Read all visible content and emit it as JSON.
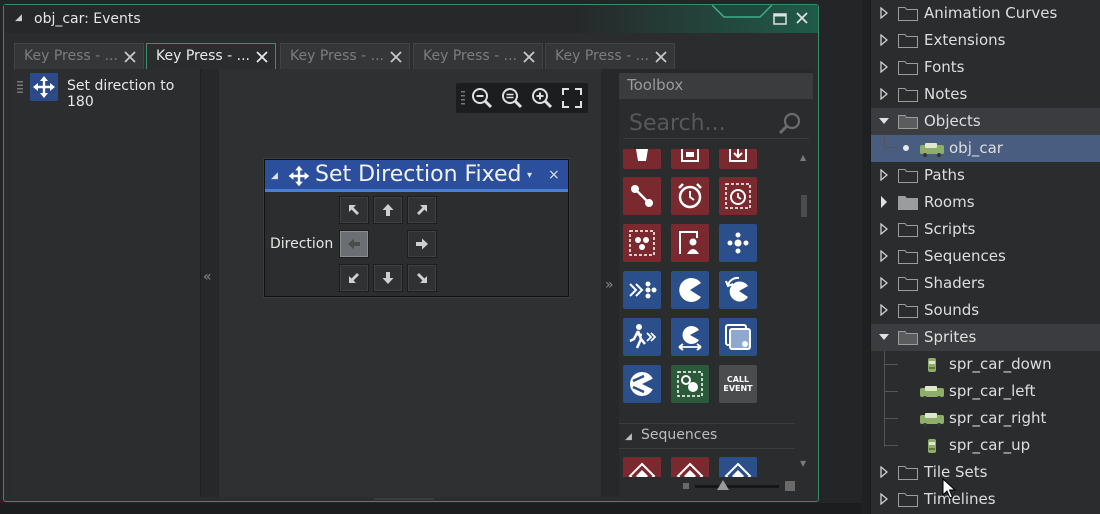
{
  "window": {
    "title": "obj_car: Events"
  },
  "tabs": [
    {
      "label": "Key Press - ...",
      "active": false
    },
    {
      "label": "Key Press - ...",
      "active": true
    },
    {
      "label": "Key Press - ...",
      "active": false
    },
    {
      "label": "Key Press - ...",
      "active": false
    },
    {
      "label": "Key Press - ...",
      "active": false
    }
  ],
  "actions_list": {
    "items": [
      {
        "label": "Set direction to 180",
        "icon": "move-arrows-icon"
      }
    ]
  },
  "canvas": {
    "collapse_left": "«",
    "collapse_right": "»",
    "zoom_tools": [
      "zoom-out-icon",
      "zoom-reset-icon",
      "zoom-in-icon",
      "fit-screen-icon"
    ]
  },
  "node": {
    "title": "Set Direction Fixed",
    "direction_label": "Direction",
    "selected_direction": "left",
    "dropdown_glyph": "▾",
    "close_glyph": "×"
  },
  "toolbox": {
    "header": "Toolbox",
    "search_placeholder": "Search...",
    "sequences_label": "Sequences",
    "call_event_line1": "CALL",
    "call_event_line2": "EVENT"
  },
  "tree": {
    "items": [
      {
        "label": "Animation Curves",
        "type": "folder",
        "expanded": false
      },
      {
        "label": "Extensions",
        "type": "folder",
        "expanded": false
      },
      {
        "label": "Fonts",
        "type": "folder",
        "expanded": false
      },
      {
        "label": "Notes",
        "type": "folder",
        "expanded": false
      },
      {
        "label": "Objects",
        "type": "folder",
        "expanded": true
      },
      {
        "label": "obj_car",
        "type": "object",
        "selected": true
      },
      {
        "label": "Paths",
        "type": "folder",
        "expanded": false
      },
      {
        "label": "Rooms",
        "type": "folder",
        "expanded": false
      },
      {
        "label": "Scripts",
        "type": "folder",
        "expanded": false
      },
      {
        "label": "Sequences",
        "type": "folder",
        "expanded": false
      },
      {
        "label": "Shaders",
        "type": "folder",
        "expanded": false
      },
      {
        "label": "Sounds",
        "type": "folder",
        "expanded": false
      },
      {
        "label": "Sprites",
        "type": "folder",
        "expanded": true
      },
      {
        "label": "spr_car_down",
        "type": "sprite"
      },
      {
        "label": "spr_car_left",
        "type": "sprite"
      },
      {
        "label": "spr_car_right",
        "type": "sprite"
      },
      {
        "label": "spr_car_up",
        "type": "sprite"
      },
      {
        "label": "Tile Sets",
        "type": "folder",
        "expanded": false
      },
      {
        "label": "Timelines",
        "type": "folder",
        "expanded": false
      }
    ]
  },
  "colors": {
    "accent_green": "#3a8a6a",
    "node_header_blue": "#2b4f9c",
    "selection_blue": "#495d80",
    "tool_red": "#7a2a2e",
    "tool_blue": "#2b4f8a",
    "tool_green": "#2a5a3a"
  }
}
